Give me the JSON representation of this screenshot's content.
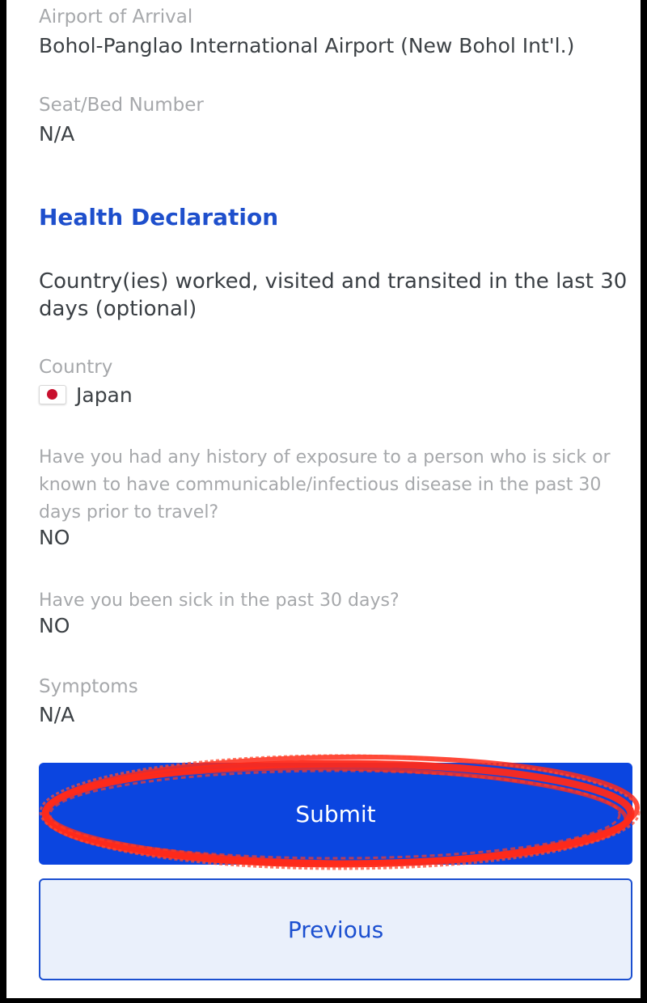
{
  "flight": {
    "airport_label": "Airport of Arrival",
    "airport_value": "Bohol-Panglao International Airport (New Bohol Int'l.)",
    "seat_label": "Seat/Bed Number",
    "seat_value": "N/A"
  },
  "health": {
    "title": "Health Declaration",
    "countries_title": "Country(ies) worked, visited and transited in the last 30 days (optional)",
    "country_label": "Country",
    "country_value": "Japan",
    "country_flag_icon": "japan-flag-icon",
    "exposure_question": "Have you had any history of exposure to a person who is sick or known to have communicable/infectious disease in the past 30 days prior to travel?",
    "exposure_answer": "NO",
    "sick_question": "Have you been sick in the past 30 days?",
    "sick_answer": "NO",
    "symptoms_label": "Symptoms",
    "symptoms_value": "N/A"
  },
  "actions": {
    "submit_label": "Submit",
    "previous_label": "Previous"
  },
  "colors": {
    "accent": "#1e4fcc",
    "submit_bg": "#0b45e0",
    "previous_bg": "#eaf0fb",
    "annotation": "#ff2a1a"
  }
}
